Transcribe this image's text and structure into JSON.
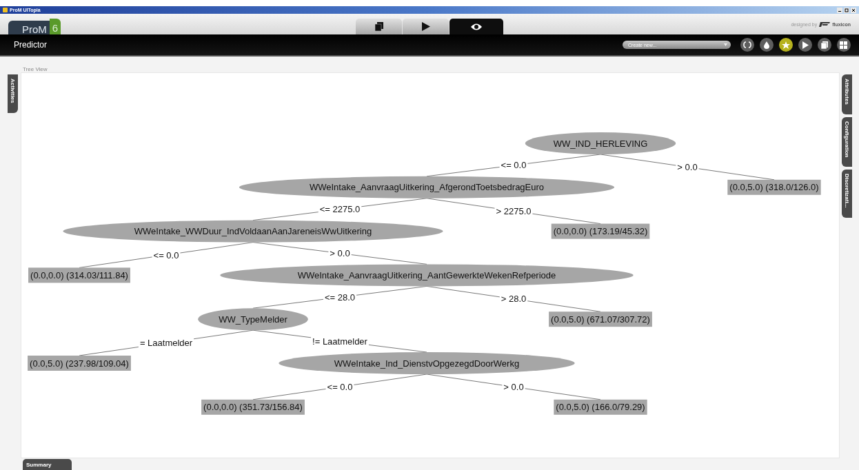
{
  "window": {
    "title": "ProM UITopia"
  },
  "header": {
    "logo_text": "ProM",
    "logo_version": "6",
    "credit": "designed by",
    "credit_brand": "fluxicon"
  },
  "view_tabs": [
    {
      "selected": false
    },
    {
      "selected": false
    },
    {
      "selected": true
    }
  ],
  "toolbar": {
    "title": "Predictor",
    "dropdown": "Create new...",
    "buttons": [
      {
        "selected": false
      },
      {
        "selected": false
      },
      {
        "selected": true
      },
      {
        "selected": false
      },
      {
        "selected": false
      },
      {
        "selected": false
      }
    ]
  },
  "left_tabs": [
    "Activities"
  ],
  "right_tabs": [
    "Attributes",
    "Configuration",
    "Discretizati..."
  ],
  "bottom_tabs": [
    "Summary"
  ],
  "panel": {
    "title": "Tree View"
  },
  "tree": {
    "label": "WW_IND_HERLEVING",
    "kind": "node",
    "children": [
      {
        "edge": "<= 0.0",
        "label": "WWeIntake_AanvraagUitkering_AfgerondToetsbedragEuro",
        "kind": "node",
        "children": [
          {
            "edge": "<= 2275.0",
            "label": "WWeIntake_WWDuur_IndVoldaanAanJareneisWwUitkering",
            "kind": "node",
            "children": [
              {
                "edge": "<= 0.0",
                "label": "(0.0,0.0) (314.03/111.84)",
                "kind": "leaf"
              },
              {
                "edge": "> 0.0",
                "label": "WWeIntake_AanvraagUitkering_AantGewerkteWekenRefperiode",
                "kind": "node",
                "children": [
                  {
                    "edge": "<= 28.0",
                    "label": "WW_TypeMelder",
                    "kind": "node",
                    "children": [
                      {
                        "edge": "= Laatmelder",
                        "label": "(0.0,5.0) (237.98/109.04)",
                        "kind": "leaf"
                      },
                      {
                        "edge": "!= Laatmelder",
                        "label": "WWeIntake_Ind_DienstvOpgezegdDoorWerkg",
                        "kind": "node",
                        "children": [
                          {
                            "edge": "<= 0.0",
                            "label": "(0.0,0.0) (351.73/156.84)",
                            "kind": "leaf"
                          },
                          {
                            "edge": "> 0.0",
                            "label": "(0.0,5.0) (166.0/79.29)",
                            "kind": "leaf"
                          }
                        ]
                      }
                    ]
                  },
                  {
                    "edge": "> 28.0",
                    "label": "(0.0,5.0) (671.07/307.72)",
                    "kind": "leaf"
                  }
                ]
              }
            ]
          },
          {
            "edge": "> 2275.0",
            "label": "(0.0,0.0) (173.19/45.32)",
            "kind": "leaf"
          }
        ]
      },
      {
        "edge": "> 0.0",
        "label": "(0.0,5.0) (318.0/126.0)",
        "kind": "leaf"
      }
    ]
  }
}
